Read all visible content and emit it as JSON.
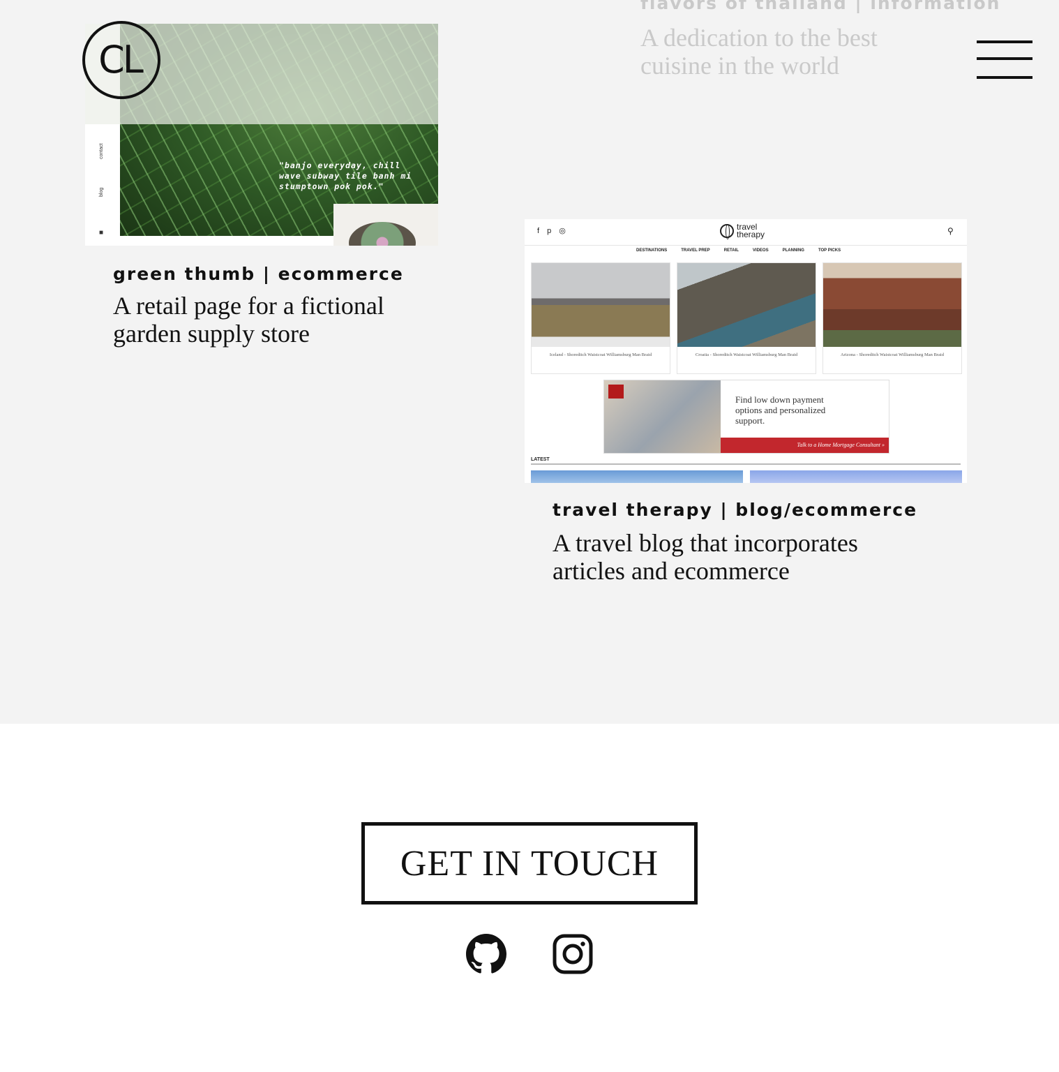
{
  "logo": {
    "text": "CL"
  },
  "menu": {
    "icon": "hamburger-icon"
  },
  "projects": [
    {
      "tag": "flavors of thailand  |  information",
      "description": "A dedication to the best cuisine in the world"
    },
    {
      "tag": "green thumb  |  ecommerce",
      "description": "A retail page for a fictional garden supply store",
      "thumbnail": {
        "quote": "\"banjo everyday, chill wave subway tile banh mi stumptown pok pok.\"",
        "sidebar": [
          "contact",
          "blog"
        ]
      }
    },
    {
      "tag": "travel therapy  |  blog/ecommerce",
      "description": "A travel blog that incorporates articles and ecommerce",
      "thumbnail": {
        "brand": "travel therapy",
        "nav": [
          "DESTINATIONS",
          "TRAVEL PREP",
          "RETAIL",
          "VIDEOS",
          "PLANNING",
          "TOP PICKS"
        ],
        "cards": [
          "Iceland - Shoreditch Waistcoat Williamsburg Man Braid",
          "Croatia - Shoreditch Waistcoat Williamsburg Man Braid",
          "Arizona - Shoreditch Waistcoat Williamsburg Man Braid"
        ],
        "ad_headline": "Find low down payment options and personalized support.",
        "ad_cta": "Talk to a Home Mortgage Consultant »",
        "latest": "LATEST"
      }
    }
  ],
  "footer": {
    "cta_label": "GET IN TOUCH",
    "social": [
      "github-icon",
      "instagram-icon"
    ]
  }
}
